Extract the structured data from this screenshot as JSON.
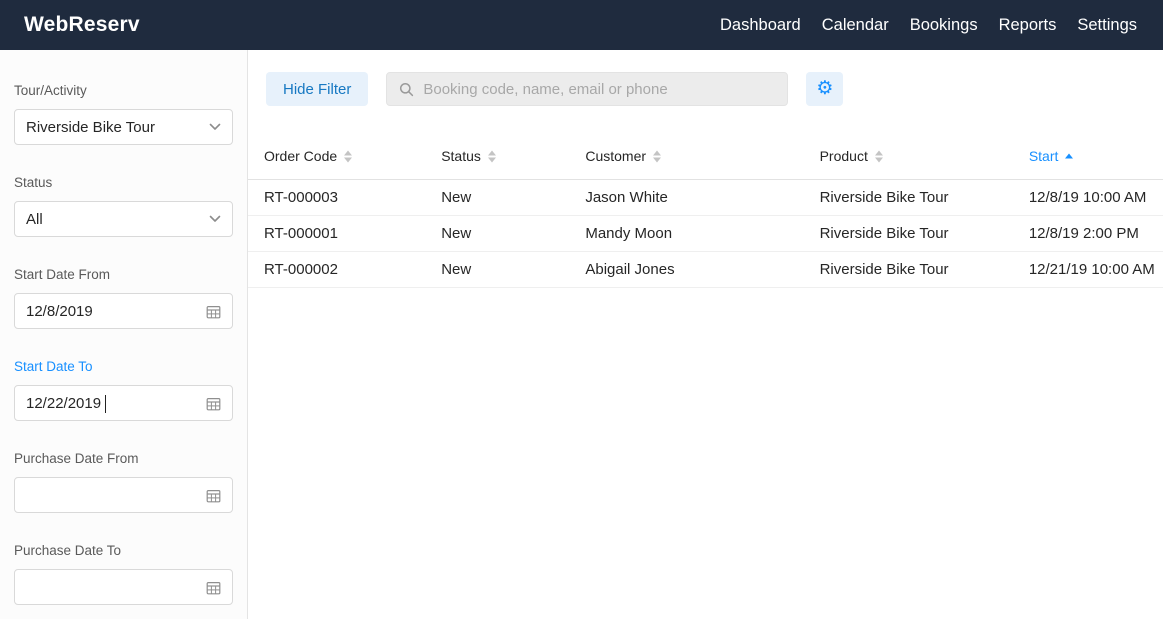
{
  "navbar": {
    "brand": "WebReserv",
    "items": [
      {
        "label": "Dashboard"
      },
      {
        "label": "Calendar"
      },
      {
        "label": "Bookings"
      },
      {
        "label": "Reports"
      },
      {
        "label": "Settings"
      }
    ]
  },
  "sidebar": {
    "filters": [
      {
        "label": "Tour/Activity",
        "type": "select",
        "value": "Riverside Bike Tour"
      },
      {
        "label": "Status",
        "type": "select",
        "value": "All"
      },
      {
        "label": "Start Date From",
        "type": "date",
        "value": "12/8/2019"
      },
      {
        "label": "Start Date To",
        "type": "date",
        "value": "12/22/2019",
        "active": true
      },
      {
        "label": "Purchase Date From",
        "type": "date",
        "value": ""
      },
      {
        "label": "Purchase Date To",
        "type": "date",
        "value": ""
      }
    ]
  },
  "toolbar": {
    "hide_filter_label": "Hide Filter",
    "search_placeholder": "Booking code, name, email or phone",
    "search_value": ""
  },
  "icons": {
    "gear": "⚙"
  },
  "table": {
    "columns": [
      {
        "label": "Order Code",
        "sort": "none"
      },
      {
        "label": "Status",
        "sort": "none"
      },
      {
        "label": "Customer",
        "sort": "none"
      },
      {
        "label": "Product",
        "sort": "none"
      },
      {
        "label": "Start",
        "sort": "asc"
      }
    ],
    "rows": [
      {
        "order_code": "RT-000003",
        "status": "New",
        "customer": "Jason White",
        "product": "Riverside Bike Tour",
        "start": "12/8/19 10:00 AM"
      },
      {
        "order_code": "RT-000001",
        "status": "New",
        "customer": "Mandy Moon",
        "product": "Riverside Bike Tour",
        "start": "12/8/19 2:00 PM"
      },
      {
        "order_code": "RT-000002",
        "status": "New",
        "customer": "Abigail Jones",
        "product": "Riverside Bike Tour",
        "start": "12/21/19 10:00 AM"
      }
    ]
  },
  "colors": {
    "navbar_bg": "#1f2b3e",
    "accent": "#1890ff",
    "accent_text": "#1678c2",
    "accent_light": "#e7f1fb"
  }
}
